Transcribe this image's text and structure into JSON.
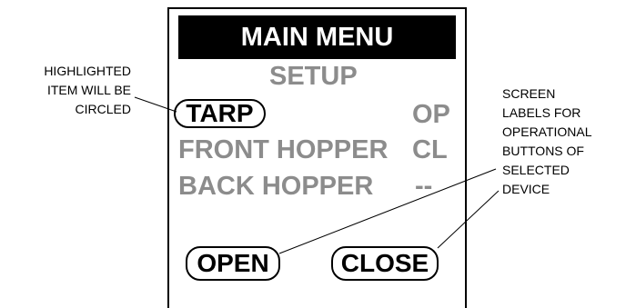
{
  "screen": {
    "title": "MAIN MENU",
    "submenu": "SETUP",
    "items": [
      {
        "label": "TARP",
        "status": "OP",
        "highlighted": true
      },
      {
        "label": "FRONT HOPPER",
        "status": "CL",
        "highlighted": false
      },
      {
        "label": "BACK HOPPER",
        "status": "--",
        "highlighted": false
      }
    ],
    "buttons": {
      "open": "OPEN",
      "close": "CLOSE"
    }
  },
  "annotations": {
    "highlight_note": [
      "HIGHLIGHTED",
      "ITEM WILL BE",
      "CIRCLED"
    ],
    "labels_note": [
      "SCREEN",
      "LABELS FOR",
      "OPERATIONAL",
      "BUTTONS OF",
      "SELECTED",
      "DEVICE"
    ]
  }
}
